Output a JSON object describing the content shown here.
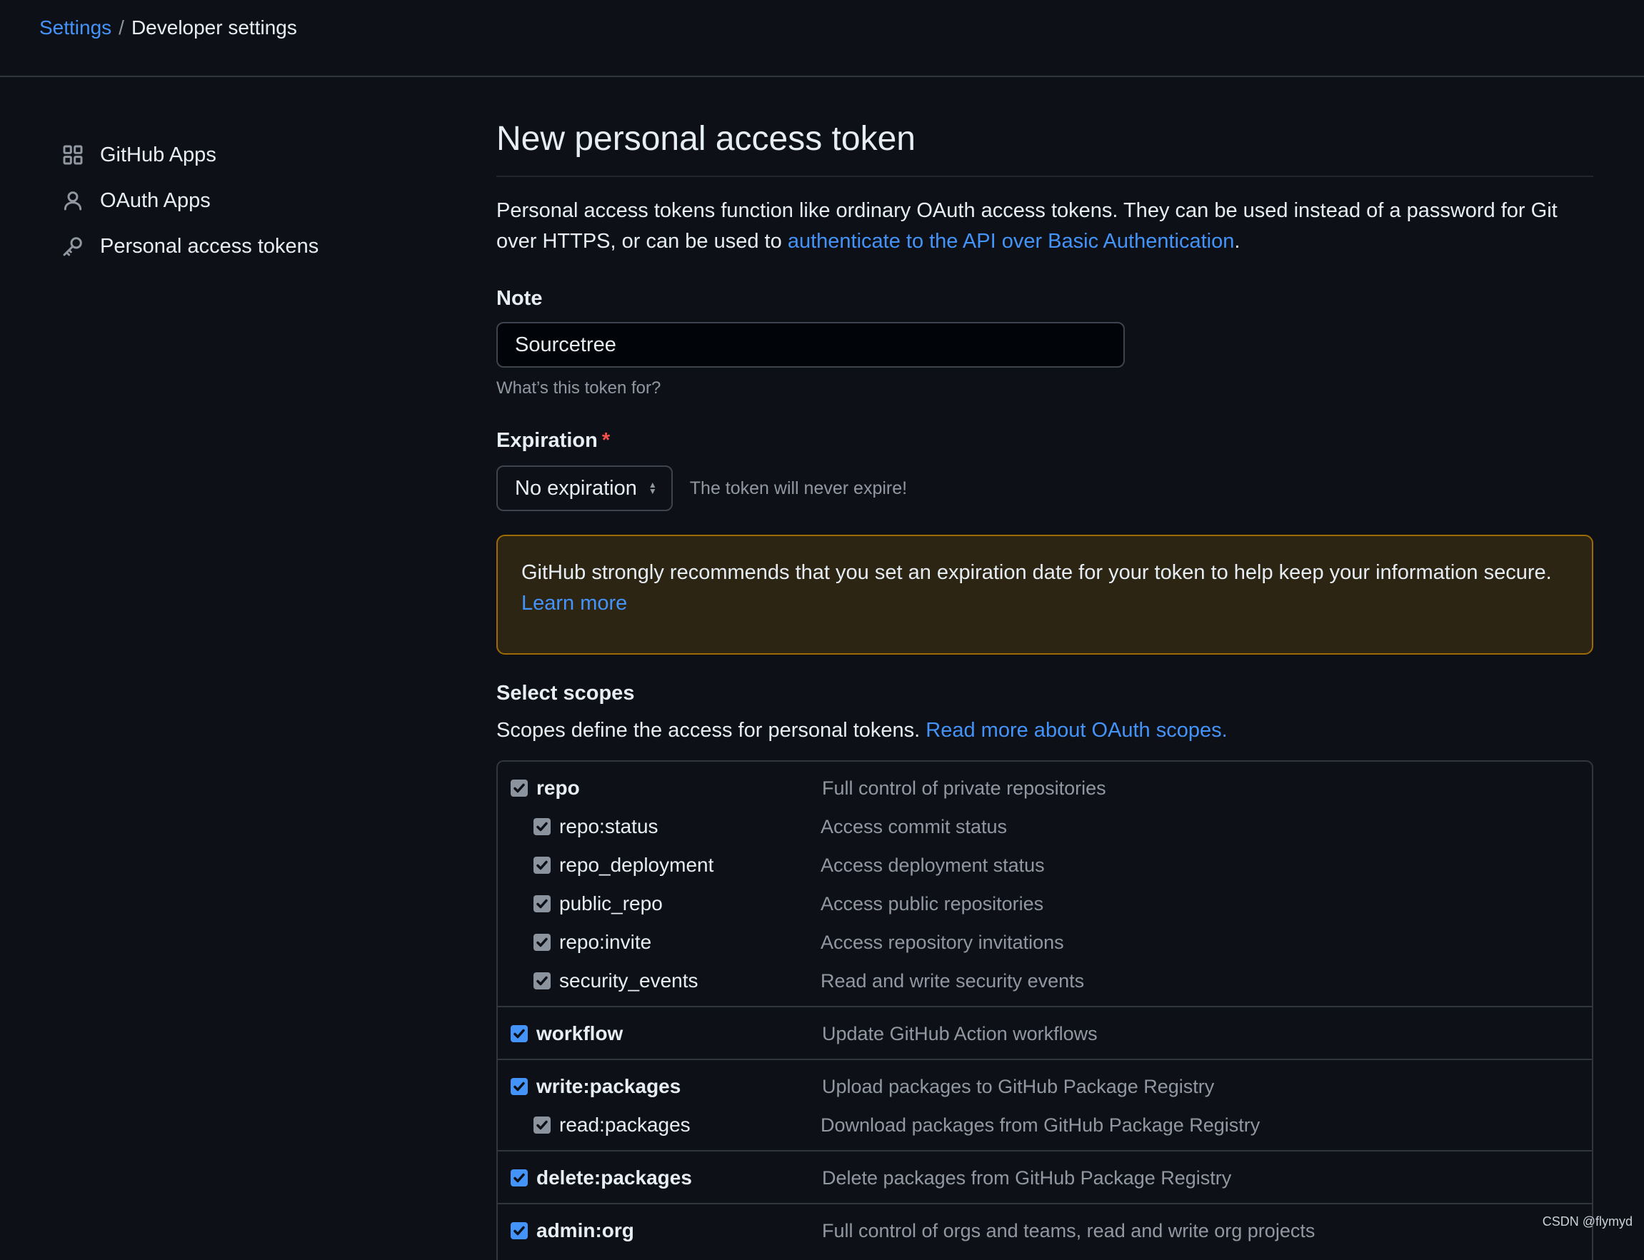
{
  "breadcrumb": {
    "root": "Settings",
    "separator": "/",
    "current": "Developer settings"
  },
  "sidebar": {
    "items": [
      {
        "label": "GitHub Apps",
        "icon": "apps-icon"
      },
      {
        "label": "OAuth Apps",
        "icon": "person-icon"
      },
      {
        "label": "Personal access tokens",
        "icon": "key-icon"
      }
    ]
  },
  "main": {
    "title": "New personal access token",
    "intro_text": "Personal access tokens function like ordinary OAuth access tokens. They can be used instead of a password for Git over HTTPS, or can be used to ",
    "intro_link": "authenticate to the API over Basic Authentication",
    "intro_end": ".",
    "note": {
      "label": "Note",
      "value": "Sourcetree",
      "hint": "What’s this token for?"
    },
    "expiration": {
      "label": "Expiration",
      "required_mark": "*",
      "selected": "No expiration",
      "note": "The token will never expire!"
    },
    "flash": {
      "text": "GitHub strongly recommends that you set an expiration date for your token to help keep your information secure.",
      "link": "Learn more"
    },
    "scopes": {
      "title": "Select scopes",
      "desc_text": "Scopes define the access for personal tokens. ",
      "desc_link": "Read more about OAuth scopes.",
      "groups": [
        {
          "name": "repo",
          "desc": "Full control of private repositories",
          "state": "indeterminate-checked",
          "children": [
            {
              "name": "repo:status",
              "desc": "Access commit status"
            },
            {
              "name": "repo_deployment",
              "desc": "Access deployment status"
            },
            {
              "name": "public_repo",
              "desc": "Access public repositories"
            },
            {
              "name": "repo:invite",
              "desc": "Access repository invitations"
            },
            {
              "name": "security_events",
              "desc": "Read and write security events"
            }
          ]
        },
        {
          "name": "workflow",
          "desc": "Update GitHub Action workflows",
          "state": "checked",
          "children": []
        },
        {
          "name": "write:packages",
          "desc": "Upload packages to GitHub Package Registry",
          "state": "checked",
          "children": [
            {
              "name": "read:packages",
              "desc": "Download packages from GitHub Package Registry"
            }
          ]
        },
        {
          "name": "delete:packages",
          "desc": "Delete packages from GitHub Package Registry",
          "state": "checked",
          "children": []
        },
        {
          "name": "admin:org",
          "desc": "Full control of orgs and teams, read and write org projects",
          "state": "checked",
          "children": []
        }
      ]
    }
  },
  "watermark": "CSDN @flymyd",
  "colors": {
    "background": "#0d1117",
    "link": "#4493f8",
    "warning_bg": "#2d2514",
    "warning_border": "#9e6a03",
    "checkbox": "#4493f8"
  }
}
